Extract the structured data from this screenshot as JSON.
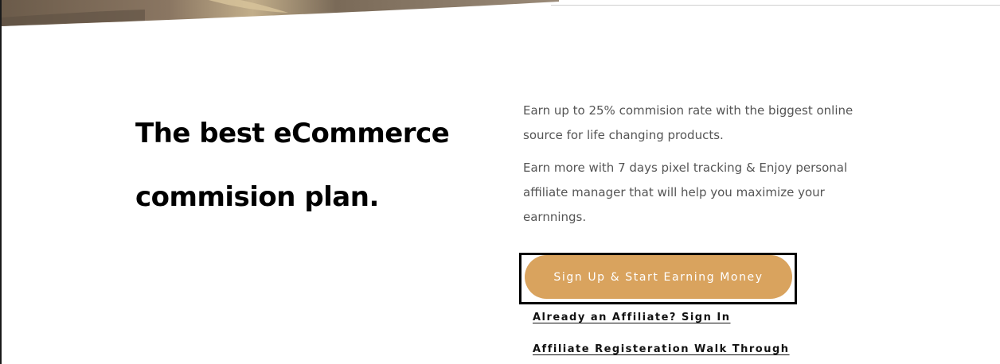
{
  "hero": {
    "image_icon": "hero-image-edge",
    "headline": {
      "line1": "The best eCommerce",
      "line2": "commision plan."
    }
  },
  "content": {
    "paragraph1": "Earn up to 25% commision rate with the biggest online source for life changing products.",
    "paragraph2": "Earn more with 7 days pixel tracking & Enjoy personal affiliate manager that will help you maximize your earnnings."
  },
  "actions": {
    "signup_label": "Sign Up & Start Earning Money",
    "signin_link": "Already an Affiliate? Sign In",
    "walkthrough_link": "Affiliate Registeration Walk Through"
  },
  "colors": {
    "button_bg": "#d9a35e",
    "button_text": "#ffffff",
    "headline": "#000000",
    "body_text": "#555555",
    "focus_outline": "#000000"
  }
}
